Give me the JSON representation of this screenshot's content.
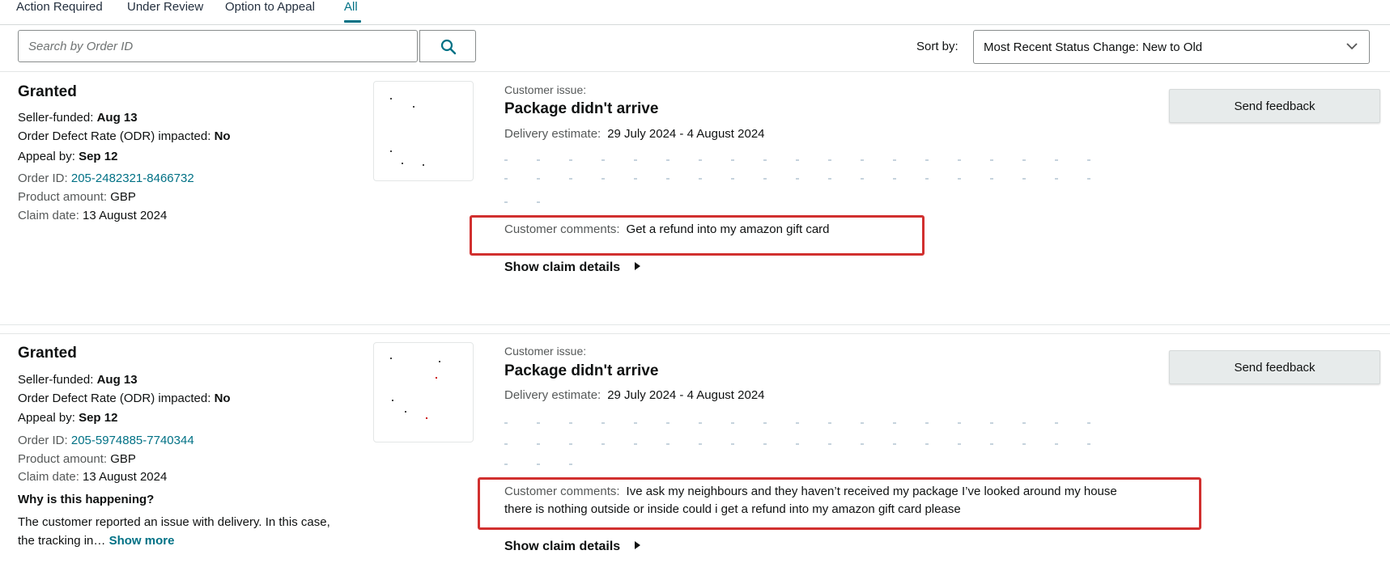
{
  "tabs": [
    {
      "label": "Action Required"
    },
    {
      "label": "Under Review"
    },
    {
      "label": "Option to Appeal"
    },
    {
      "label": "All"
    }
  ],
  "active_tab": "All",
  "search": {
    "placeholder": "Search by Order ID",
    "value": ""
  },
  "sort": {
    "label": "Sort by:",
    "value": "Most Recent Status Change: New to Old"
  },
  "colors": {
    "accent": "#007185",
    "highlight_border": "#d1302f"
  },
  "claims": [
    {
      "status": "Granted",
      "seller_funded_label": "Seller-funded:",
      "seller_funded_value": "Aug 13",
      "odr_label": "Order Defect Rate (ODR) impacted:",
      "odr_value": "No",
      "appeal_label": "Appeal by:",
      "appeal_value": "Sep 12",
      "order_id_label": "Order ID:",
      "order_id_value": "205-2482321-8466732",
      "product_amount_label": "Product amount:",
      "product_amount_value": "GBP",
      "claim_date_label": "Claim date:",
      "claim_date_value": "13 August 2024",
      "issue_label": "Customer issue:",
      "issue_title": "Package didn't arrive",
      "delivery_label": "Delivery estimate:",
      "delivery_value": "29 July 2024 - 4 August 2024",
      "comments_label": "Customer comments:",
      "comments_value": "Get a refund into my amazon gift card",
      "show_details": "Show claim details",
      "feedback_button": "Send feedback"
    },
    {
      "status": "Granted",
      "seller_funded_label": "Seller-funded:",
      "seller_funded_value": "Aug 13",
      "odr_label": "Order Defect Rate (ODR) impacted:",
      "odr_value": "No",
      "appeal_label": "Appeal by:",
      "appeal_value": "Sep 12",
      "order_id_label": "Order ID:",
      "order_id_value": "205-5974885-7740344",
      "product_amount_label": "Product amount:",
      "product_amount_value": "GBP",
      "claim_date_label": "Claim date:",
      "claim_date_value": "13 August 2024",
      "why_title": "Why is this happening?",
      "why_text": "The customer reported an issue with delivery. In this case, the tracking in…",
      "show_more": "Show more",
      "issue_label": "Customer issue:",
      "issue_title": "Package didn't arrive",
      "delivery_label": "Delivery estimate:",
      "delivery_value": "29 July 2024 - 4 August 2024",
      "comments_label": "Customer comments:",
      "comments_value": "Ive ask my neighbours and they haven’t received my package I’ve looked around my house there is nothing outside or inside could i get a refund into my amazon gift card please",
      "show_details": "Show claim details",
      "feedback_button": "Send feedback"
    }
  ],
  "icons": {
    "search": "search-icon",
    "sort": "chevron-down-icon",
    "expand": "caret-right-icon"
  }
}
